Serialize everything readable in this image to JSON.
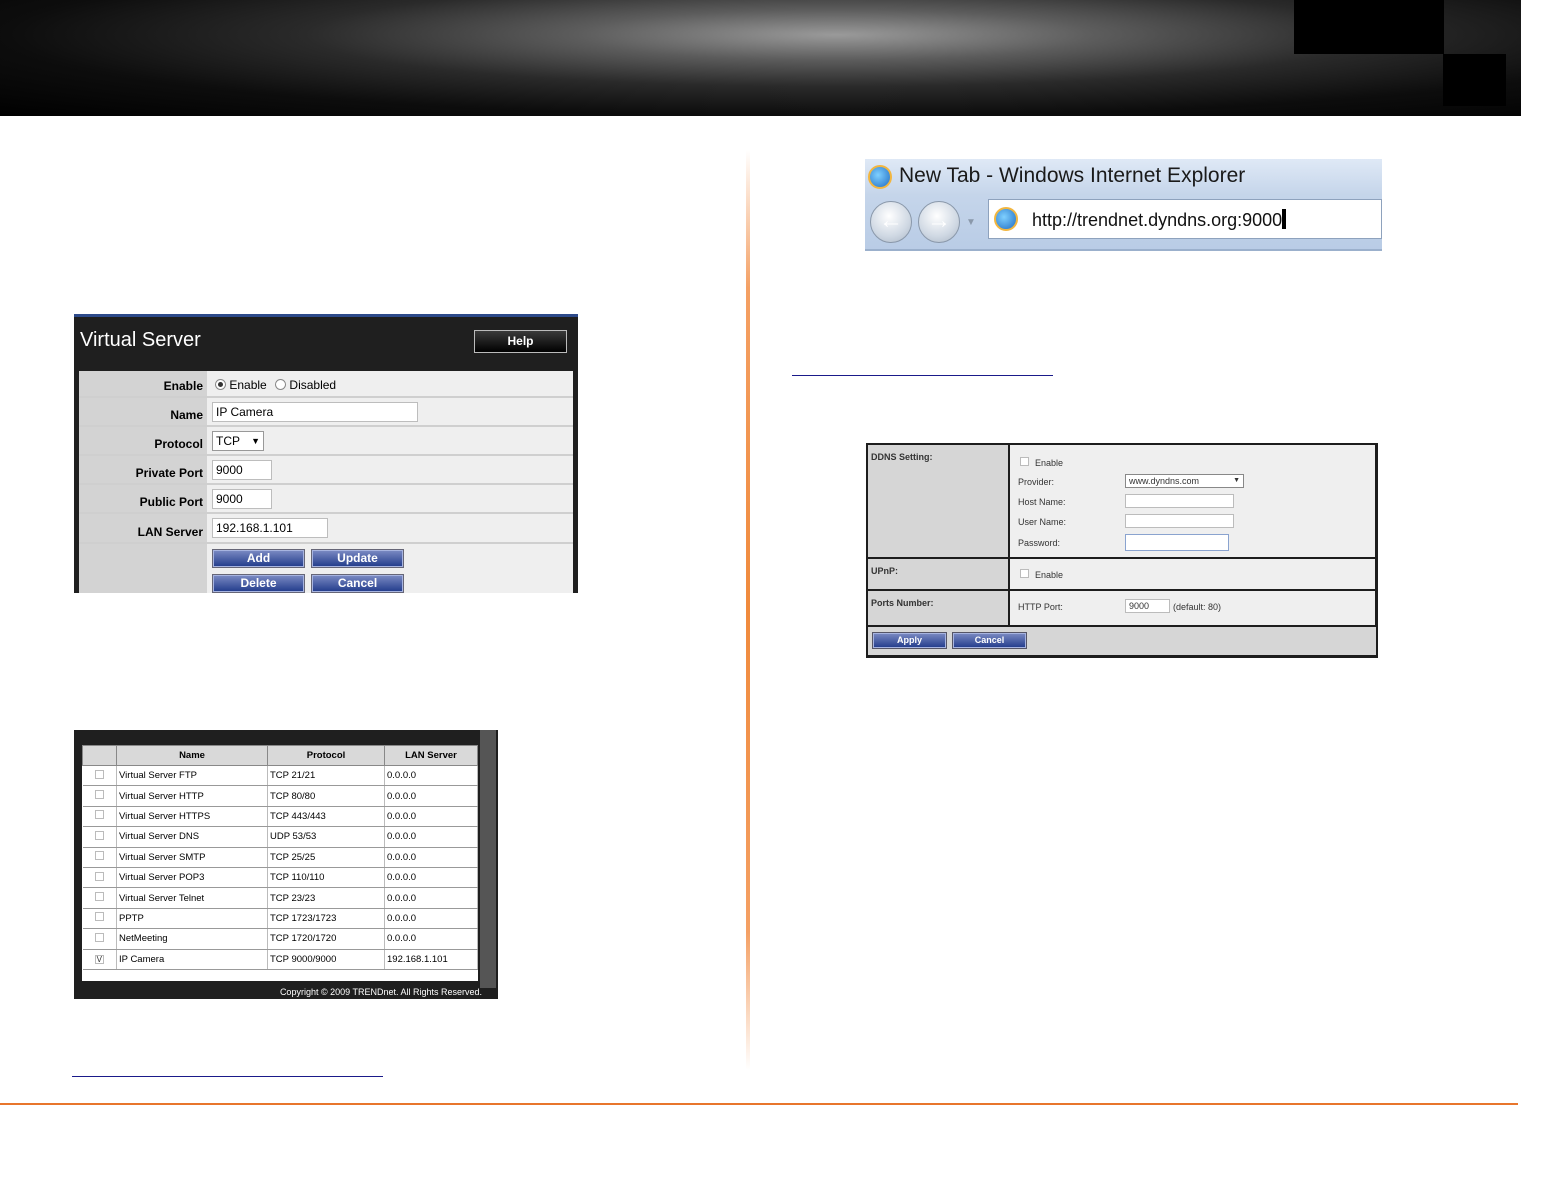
{
  "virtual_server": {
    "title": "Virtual Server",
    "help_label": "Help",
    "enable_label": "Enable",
    "enable_option": "Enable",
    "disabled_option": "Disabled",
    "name_label": "Name",
    "name_value": "IP Camera",
    "protocol_label": "Protocol",
    "protocol_value": "TCP",
    "private_port_label": "Private Port",
    "private_port_value": "9000",
    "public_port_label": "Public Port",
    "public_port_value": "9000",
    "lan_server_label": "LAN Server",
    "lan_server_value": "192.168.1.101",
    "buttons": {
      "add": "Add",
      "update": "Update",
      "delete": "Delete",
      "cancel": "Cancel"
    }
  },
  "server_list": {
    "columns": [
      "Name",
      "Protocol",
      "LAN Server"
    ],
    "rows": [
      {
        "name": "Virtual Server FTP",
        "protocol": "TCP 21/21",
        "lan": "0.0.0.0",
        "checked": ""
      },
      {
        "name": "Virtual Server HTTP",
        "protocol": "TCP 80/80",
        "lan": "0.0.0.0",
        "checked": ""
      },
      {
        "name": "Virtual Server HTTPS",
        "protocol": "TCP 443/443",
        "lan": "0.0.0.0",
        "checked": ""
      },
      {
        "name": "Virtual Server DNS",
        "protocol": "UDP 53/53",
        "lan": "0.0.0.0",
        "checked": ""
      },
      {
        "name": "Virtual Server SMTP",
        "protocol": "TCP 25/25",
        "lan": "0.0.0.0",
        "checked": ""
      },
      {
        "name": "Virtual Server POP3",
        "protocol": "TCP 110/110",
        "lan": "0.0.0.0",
        "checked": ""
      },
      {
        "name": "Virtual Server Telnet",
        "protocol": "TCP 23/23",
        "lan": "0.0.0.0",
        "checked": ""
      },
      {
        "name": "PPTP",
        "protocol": "TCP 1723/1723",
        "lan": "0.0.0.0",
        "checked": ""
      },
      {
        "name": "NetMeeting",
        "protocol": "TCP 1720/1720",
        "lan": "0.0.0.0",
        "checked": ""
      },
      {
        "name": "IP Camera",
        "protocol": "TCP 9000/9000",
        "lan": "192.168.1.101",
        "checked": "V"
      }
    ],
    "copyright": "Copyright © 2009 TRENDnet. All Rights Reserved."
  },
  "browser": {
    "window_title": "New Tab - Windows Internet Explorer",
    "url": "http://trendnet.dyndns.org:9000"
  },
  "ddns": {
    "ddns_setting_label": "DDNS Setting:",
    "enable_label": "Enable",
    "provider_label": "Provider:",
    "provider_value": "www.dyndns.com",
    "host_name_label": "Host Name:",
    "user_name_label": "User Name:",
    "password_label": "Password:",
    "upnp_label": "UPnP:",
    "upnp_enable_label": "Enable",
    "ports_number_label": "Ports Number:",
    "http_port_label": "HTTP Port:",
    "http_port_value": "9000",
    "http_port_default": "(default: 80)",
    "apply_label": "Apply",
    "cancel_label": "Cancel"
  }
}
